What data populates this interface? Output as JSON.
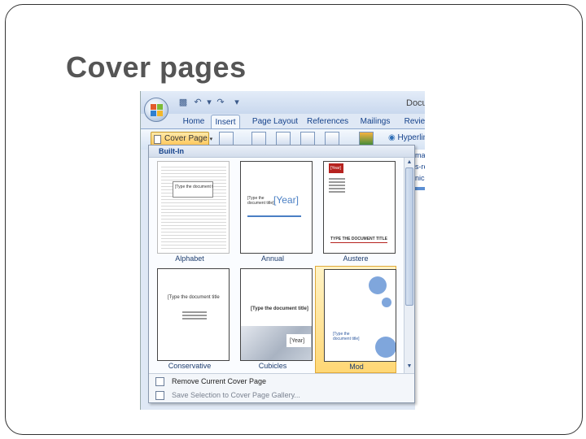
{
  "slide": {
    "title": "Cover pages"
  },
  "window": {
    "title": "Docum",
    "tabs": [
      {
        "label": "Home",
        "active": false
      },
      {
        "label": "Insert",
        "active": true
      },
      {
        "label": "Page Layout",
        "active": false
      },
      {
        "label": "References",
        "active": false
      },
      {
        "label": "Mailings",
        "active": false
      },
      {
        "label": "Review",
        "active": false
      }
    ],
    "ribbon": {
      "cover_page_button": "Cover Page",
      "hyperlink_label": "Hyperlink"
    },
    "right_strip": [
      "mark",
      "s-refe",
      "nics"
    ]
  },
  "gallery": {
    "header": "Built-In",
    "items": [
      {
        "name": "Alphabet",
        "placeholder": "[Type the document t",
        "selected": false
      },
      {
        "name": "Annual",
        "placeholder": "[Type the document title]",
        "year": "[Year]",
        "selected": false
      },
      {
        "name": "Austere",
        "placeholder": "TYPE THE DOCUMENT TITLE",
        "year": "[Year]",
        "selected": false
      },
      {
        "name": "Conservative",
        "placeholder": "[Type the document title",
        "selected": false
      },
      {
        "name": "Cubicles",
        "placeholder": "[Type the document title]",
        "year": "[Year]",
        "selected": false
      },
      {
        "name": "Mod",
        "placeholder": "[Type the document title]",
        "selected": true
      }
    ],
    "footer": {
      "remove": "Remove Current Cover Page",
      "save": "Save Selection to Cover Page Gallery..."
    }
  },
  "colors": {
    "ribbon_blue": "#15428b",
    "selection": "#ffd775",
    "mod_circle": "#7fa6dc"
  }
}
